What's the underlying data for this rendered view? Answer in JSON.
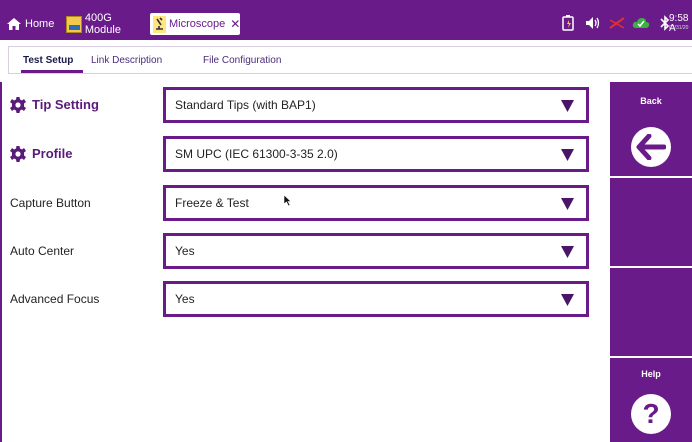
{
  "topbar": {
    "tabs": [
      {
        "label": "Home",
        "icon": "home-icon"
      },
      {
        "label": "400G Module",
        "icon": "module-icon"
      },
      {
        "label": "Microscope",
        "icon": "microscope-icon",
        "active": true
      }
    ],
    "close_glyph": "✕",
    "status_icons": [
      "battery-plug-icon",
      "speaker-icon",
      "network-disconnected-icon",
      "cloud-icon",
      "bluetooth-icon"
    ],
    "clock": "9:58 A",
    "date": "03/31/20"
  },
  "subtabs": [
    "Test Setup",
    "Link Description",
    "File Configuration"
  ],
  "settings": [
    {
      "label": "Tip Setting",
      "value": "Standard Tips (with BAP1)"
    },
    {
      "label": "Profile",
      "value": "SM UPC (IEC 61300-3-35 2.0)"
    },
    {
      "label": "Capture Button",
      "value": "Freeze & Test"
    },
    {
      "label": "Auto Center",
      "value": "Yes"
    },
    {
      "label": "Advanced Focus",
      "value": "Yes"
    }
  ],
  "sidepanel": {
    "back_label": "Back",
    "help_label": "Help",
    "help_glyph": "?"
  },
  "colors": {
    "accent": "#6a1b8a",
    "text": "#222222",
    "background": "#ffffff"
  }
}
